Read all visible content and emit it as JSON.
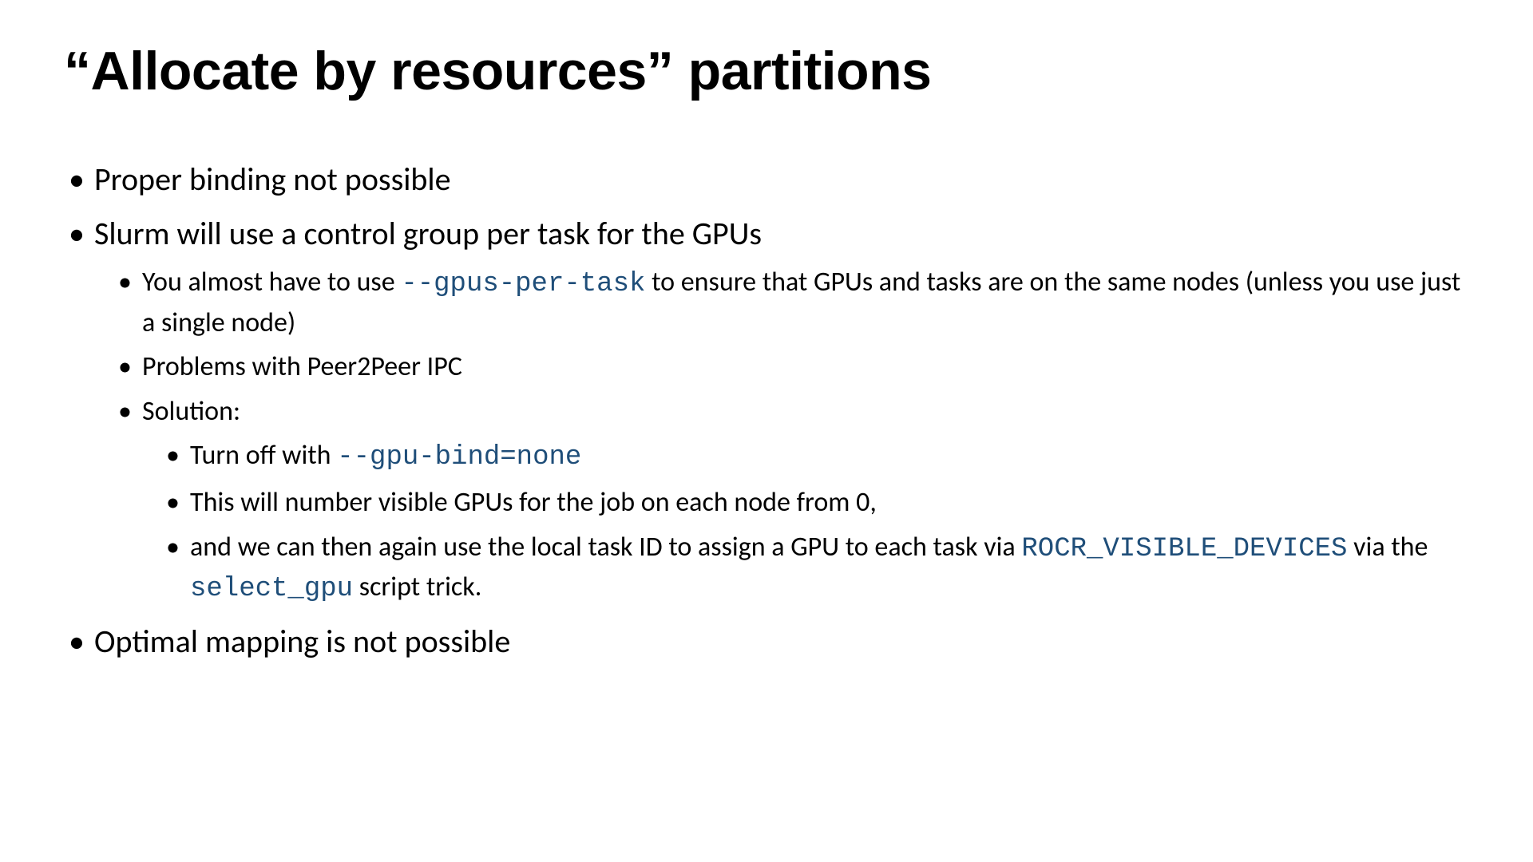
{
  "title": "“Allocate by resources” partitions",
  "bullets": {
    "b1": "Proper binding not possible",
    "b2": "Slurm will use a control group per task for the GPUs",
    "b2_1a": "You almost have to use ",
    "b2_1_code": "--gpus-per-task",
    "b2_1b": " to ensure that GPUs and tasks are on the same nodes (unless you use just a single node)",
    "b2_2": "Problems with Peer2Peer IPC",
    "b2_3": "Solution:",
    "b2_3_1a": "Turn off with ",
    "b2_3_1_code": "--gpu-bind=none",
    "b2_3_2": "This will number visible GPUs for the job on each node from 0,",
    "b2_3_3a": "and we can then again use the local task ID to assign a GPU to each task via ",
    "b2_3_3_code1": "ROCR_VISIBLE_DEVICES",
    "b2_3_3b": " via the ",
    "b2_3_3_code2": "select_gpu",
    "b2_3_3c": " script trick.",
    "b3": "Optimal mapping is not possible"
  }
}
